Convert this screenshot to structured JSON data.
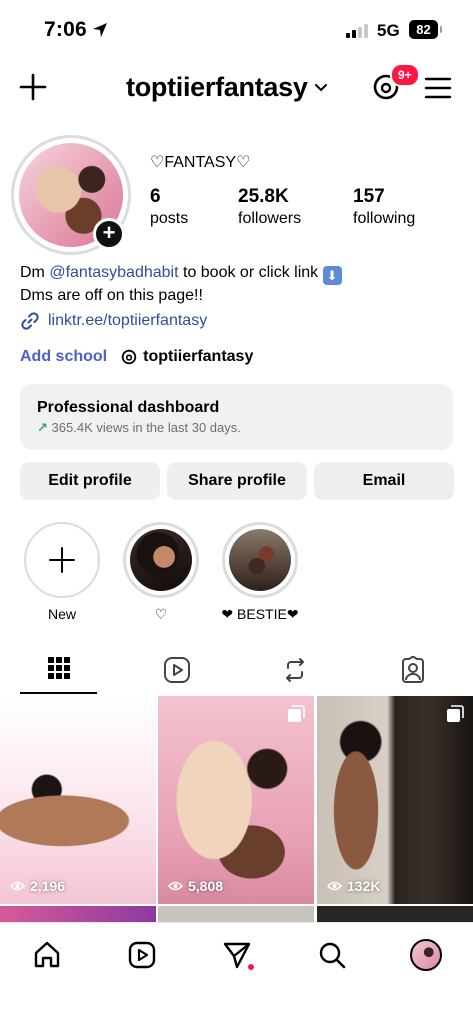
{
  "status": {
    "time": "7:06",
    "network": "5G",
    "battery": "82"
  },
  "header": {
    "username": "toptiierfantasy",
    "notification_badge": "9+"
  },
  "profile": {
    "display_name": "♡FANTASY♡",
    "stats": [
      {
        "value": "6",
        "label": "posts"
      },
      {
        "value": "25.8K",
        "label": "followers"
      },
      {
        "value": "157",
        "label": "following"
      }
    ],
    "bio_line1_pre": "Dm ",
    "bio_mention": "@fantasybadhabit",
    "bio_line1_post": " to book or click link",
    "bio_line2": "Dms are off on this page!!",
    "link": "linktr.ee/toptiierfantasy",
    "add_school": "Add school",
    "threads_handle": "toptiierfantasy"
  },
  "dashboard": {
    "title": "Professional dashboard",
    "subtitle": "365.4K views in the last 30 days."
  },
  "buttons": {
    "edit": "Edit profile",
    "share": "Share profile",
    "email": "Email"
  },
  "highlights": [
    {
      "label": "New"
    },
    {
      "label": "♡"
    },
    {
      "label": "❤ BESTIE❤"
    }
  ],
  "posts": [
    {
      "views": "2,196"
    },
    {
      "views": "5,808"
    },
    {
      "views": "132K"
    }
  ],
  "icons": [
    "plus-icon",
    "chevron-down-icon",
    "threads-icon",
    "menu-icon",
    "link-icon",
    "grid-icon",
    "reels-icon",
    "reposts-icon",
    "tagged-icon",
    "home-icon",
    "explore-send-icon",
    "search-icon",
    "eye-icon",
    "carousel-icon"
  ],
  "colors": {
    "link_blue": "#2d4ea1",
    "badge_red": "#ff1744",
    "button_gray": "#eeeff1",
    "trend_green": "#3aa655"
  }
}
